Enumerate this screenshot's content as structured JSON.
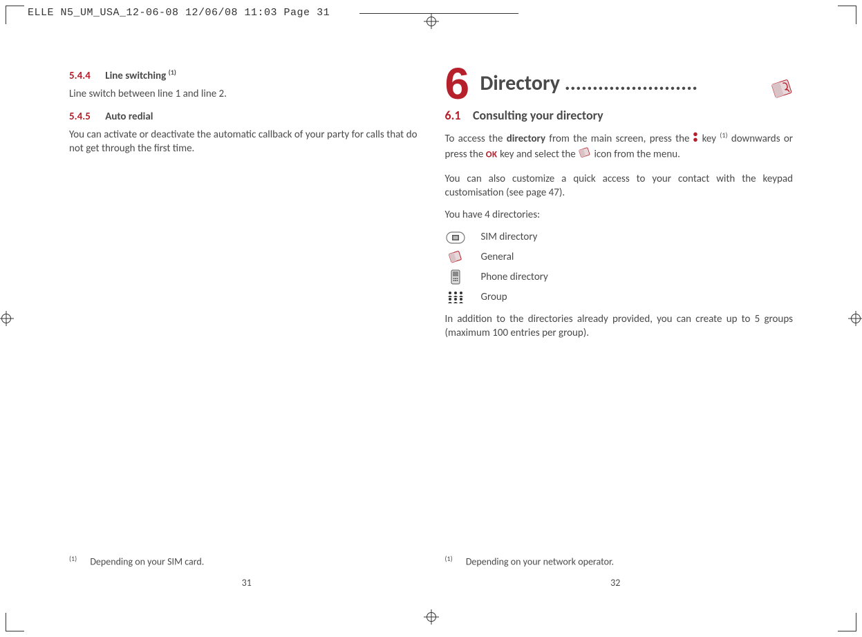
{
  "slug": "ELLE N5_UM_USA_12-06-08  12/06/08  11:03  Page 31",
  "left": {
    "s544_num": "5.4.4",
    "s544_title": "Line switching",
    "s544_sup": "(1)",
    "s544_body": "Line switch between line 1 and line 2.",
    "s545_num": "5.4.5",
    "s545_title": "Auto redial",
    "s545_body": "You can activate or deactivate the automatic callback of your party for calls that do not get through the first time.",
    "footnote_sup": "(1)",
    "footnote": "Depending on your SIM card.",
    "pagenum": "31"
  },
  "right": {
    "chapter_num": "6",
    "chapter_title": "Directory ........................",
    "s61_num": "6.1",
    "s61_title": "Consulting your directory",
    "p1_a": "To access the ",
    "p1_bold": "directory",
    "p1_b": " from the main screen, press the ",
    "p1_c": " key ",
    "p1_sup": "(1)",
    "p1_d": " downwards or press the ",
    "ok": "OK",
    "p1_e": " key and select the ",
    "p1_f": " icon from the menu.",
    "p2": "You can also customize a quick access to your contact with the keypad customisation (see page 47).",
    "p3": "You have 4 directories:",
    "dir1": "SIM directory",
    "dir2": "General",
    "dir3": "Phone directory",
    "dir4": "Group",
    "p4": "In addition to the directories already provided, you can create up to 5 groups (maximum 100 entries per group).",
    "footnote_sup": "(1)",
    "footnote": "Depending on your network operator.",
    "pagenum": "32"
  }
}
